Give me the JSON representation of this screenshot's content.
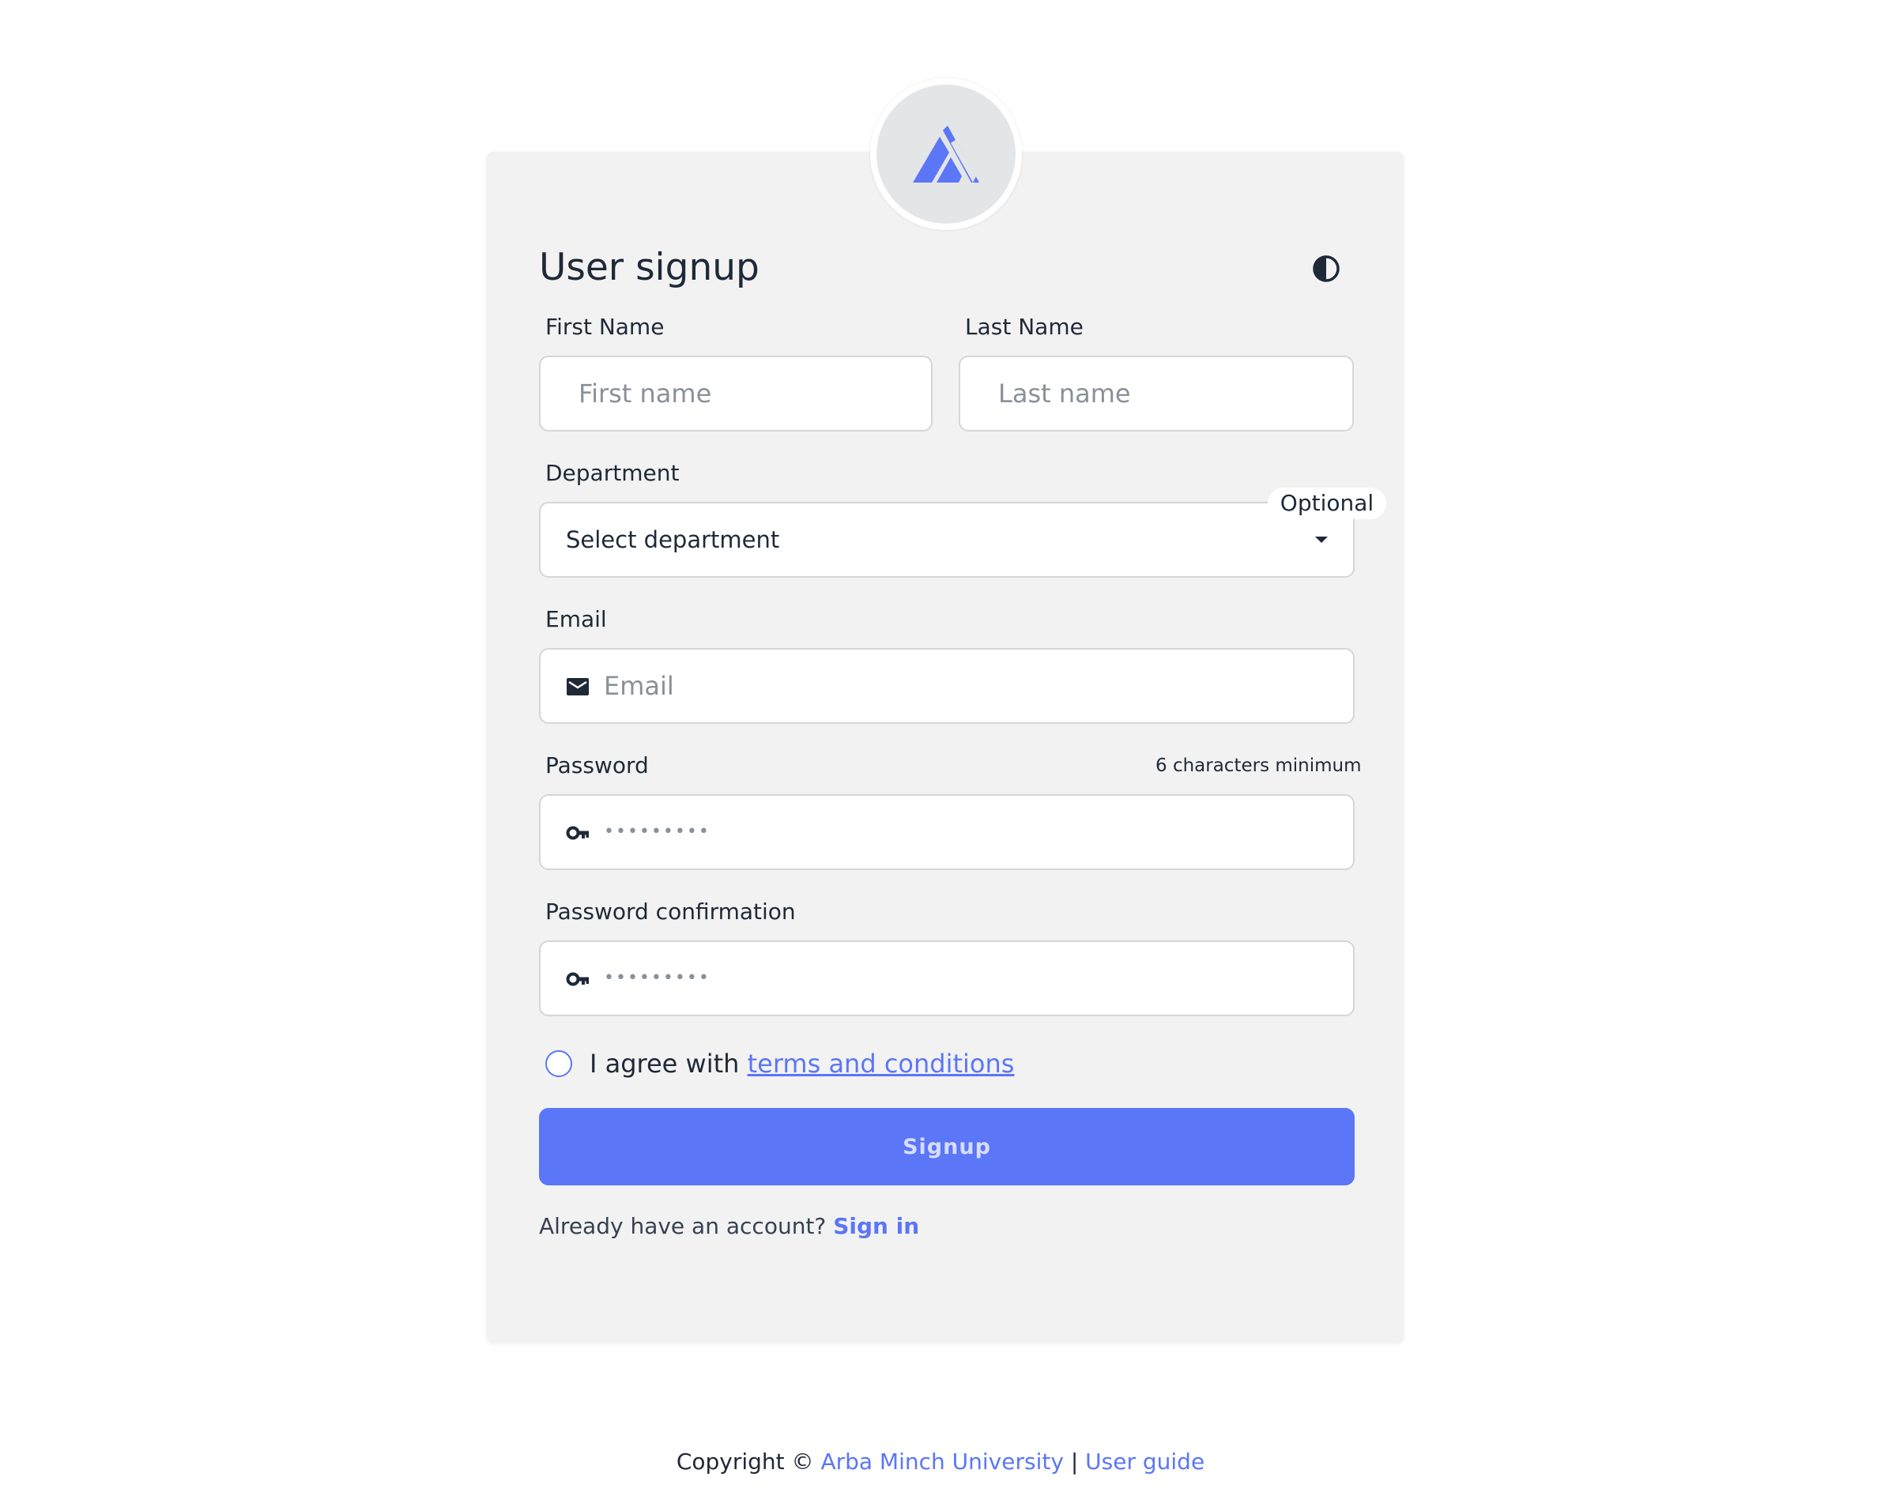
{
  "form": {
    "title": "User signup",
    "first_name": {
      "label": "First Name",
      "placeholder": "First name"
    },
    "last_name": {
      "label": "Last Name",
      "placeholder": "Last name"
    },
    "department": {
      "label": "Department",
      "selected": "Select department",
      "badge": "Optional"
    },
    "email": {
      "label": "Email",
      "placeholder": "Email"
    },
    "password": {
      "label": "Password",
      "hint": "6 characters minimum",
      "masked": "•••••••••"
    },
    "password_confirmation": {
      "label": "Password confirmation",
      "masked": "•••••••••"
    },
    "agree": {
      "text": "I agree with",
      "link": "terms and conditions"
    },
    "submit_label": "Signup",
    "signin": {
      "prompt": "Already have an account?",
      "link": "Sign in"
    }
  },
  "footer": {
    "copyright": "Copyright ©",
    "org_link": "Arba Minch University",
    "separator": "|",
    "guide_link": "User guide"
  },
  "icons": {
    "logo": "mountain-logo-icon",
    "theme": "half-circle-contrast-icon",
    "email": "envelope-icon",
    "password": "key-icon",
    "dropdown": "caret-down-icon"
  },
  "colors": {
    "accent": "#5b76f7",
    "card_bg": "#f2f2f2",
    "text": "#1f2937",
    "placeholder": "#8a9099"
  }
}
